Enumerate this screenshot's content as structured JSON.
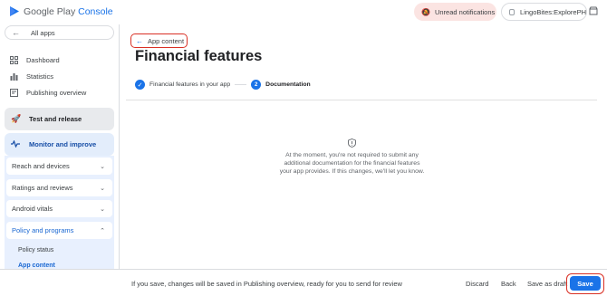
{
  "header": {
    "logo_prefix": "Google Play",
    "logo_accent": "Console",
    "notifications_label": "Unread notifications",
    "account_label": "LingoBites:ExplorePH"
  },
  "sidebar": {
    "all_apps": "All apps",
    "items": [
      {
        "label": "Dashboard",
        "icon": "dashboard-icon"
      },
      {
        "label": "Statistics",
        "icon": "statistics-icon"
      },
      {
        "label": "Publishing overview",
        "icon": "publishing-overview-icon"
      }
    ],
    "test_release": "Test and release",
    "monitor_improve": "Monitor and improve",
    "sections": [
      {
        "label": "Reach and devices"
      },
      {
        "label": "Ratings and reviews"
      },
      {
        "label": "Android vitals"
      }
    ],
    "policy": {
      "label": "Policy and programs",
      "children": [
        {
          "label": "Policy status"
        },
        {
          "label": "App content"
        }
      ]
    }
  },
  "main": {
    "back_link": "App content",
    "title": "Financial features",
    "steps": [
      {
        "label": "Financial features in your app",
        "state": "done"
      },
      {
        "label": "Documentation",
        "state": "current",
        "number": "2"
      }
    ],
    "info": "At the moment, you're not required to submit any additional documentation for the financial features your app provides. If this changes, we'll let you know."
  },
  "footer": {
    "message": "If you save, changes will be saved in Publishing overview, ready for you to send for review",
    "discard": "Discard",
    "back": "Back",
    "save_draft": "Save as draft",
    "save": "Save"
  },
  "colors": {
    "accent": "#1a73e8",
    "highlight_outline": "#d93025",
    "notification_bg": "#fbe4e2",
    "active_nav_bg": "#e3edfb"
  }
}
